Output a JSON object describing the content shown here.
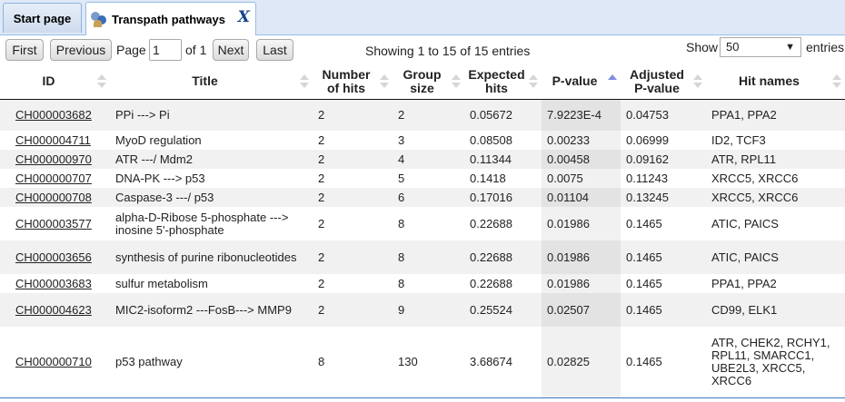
{
  "tabs": [
    {
      "label": "Start page"
    },
    {
      "label": "Transpath pathways",
      "close": "X"
    }
  ],
  "controls": {
    "first": "First",
    "previous": "Previous",
    "page_label": "Page",
    "page_value": "1",
    "of_label": "of 1",
    "next": "Next",
    "last": "Last",
    "showing": "Showing 1 to 15 of 15 entries",
    "show_label": "Show",
    "show_value": "50",
    "entries_label": "entries"
  },
  "table": {
    "headers": [
      "ID",
      "Title",
      "Number of hits",
      "Group size",
      "Expected hits",
      "P-value",
      "Adjusted P-value",
      "Hit names"
    ],
    "sorted_column": "P-value",
    "rows": [
      {
        "id": "CH000003682",
        "title": "PPi ---> Pi",
        "hits": "2",
        "group": "2",
        "expected": "0.05672",
        "p": "7.9223E-4",
        "adj": "0.04753",
        "names": "PPA1, PPA2"
      },
      {
        "id": "CH000004711",
        "title": "MyoD regulation",
        "hits": "2",
        "group": "3",
        "expected": "0.08508",
        "p": "0.00233",
        "adj": "0.06999",
        "names": "ID2, TCF3"
      },
      {
        "id": "CH000000970",
        "title": "ATR ---/ Mdm2",
        "hits": "2",
        "group": "4",
        "expected": "0.11344",
        "p": "0.00458",
        "adj": "0.09162",
        "names": "ATR, RPL11"
      },
      {
        "id": "CH000000707",
        "title": "DNA-PK ---> p53",
        "hits": "2",
        "group": "5",
        "expected": "0.1418",
        "p": "0.0075",
        "adj": "0.11243",
        "names": "XRCC5, XRCC6"
      },
      {
        "id": "CH000000708",
        "title": "Caspase-3 ---/ p53",
        "hits": "2",
        "group": "6",
        "expected": "0.17016",
        "p": "0.01104",
        "adj": "0.13245",
        "names": "XRCC5, XRCC6"
      },
      {
        "id": "CH000003577",
        "title": "alpha-D-Ribose 5-phosphate ---> inosine 5'-phosphate",
        "hits": "2",
        "group": "8",
        "expected": "0.22688",
        "p": "0.01986",
        "adj": "0.1465",
        "names": "ATIC, PAICS"
      },
      {
        "id": "CH000003656",
        "title": "synthesis of purine ribonucleotides",
        "hits": "2",
        "group": "8",
        "expected": "0.22688",
        "p": "0.01986",
        "adj": "0.1465",
        "names": "ATIC, PAICS"
      },
      {
        "id": "CH000003683",
        "title": "sulfur metabolism",
        "hits": "2",
        "group": "8",
        "expected": "0.22688",
        "p": "0.01986",
        "adj": "0.1465",
        "names": "PPA1, PPA2"
      },
      {
        "id": "CH000004623",
        "title": "MIC2-isoform2 ---FosB---> MMP9",
        "hits": "2",
        "group": "9",
        "expected": "0.25524",
        "p": "0.02507",
        "adj": "0.1465",
        "names": "CD99, ELK1"
      },
      {
        "id": "CH000000710",
        "title": "p53 pathway",
        "hits": "8",
        "group": "130",
        "expected": "3.68674",
        "p": "0.02825",
        "adj": "0.1465",
        "names": "ATR, CHEK2, RCHY1, RPL11, SMARCC1, UBE2L3, XRCC5, XRCC6"
      }
    ]
  }
}
